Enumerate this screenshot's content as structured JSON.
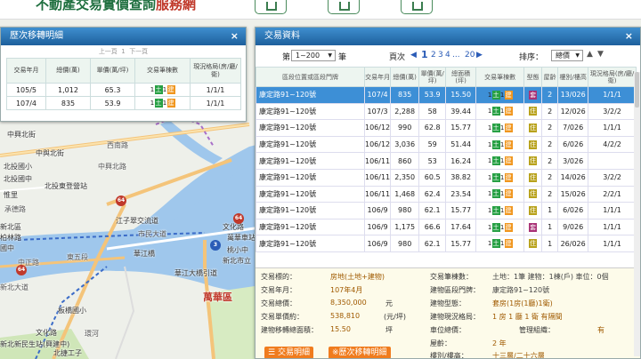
{
  "site": {
    "title_main": "不動產交易實價查詢",
    "title_accent": "服務網"
  },
  "map": {
    "labels": [
      "中興北街",
      "中與北街",
      "西南路",
      "中興北路",
      "北投國小",
      "北投國中",
      "承德路",
      "北投東登營站",
      "江子翠交流道",
      "華江橋",
      "萬華區",
      "華江大橋引道",
      "中正路",
      "文化路",
      "板橋國小",
      "市民大道",
      "東五段",
      "新北大道",
      "文化路",
      "萬華車站",
      "桃小中",
      "新北市立",
      "新北區",
      "柏林路",
      "國中",
      "惟里",
      "新北新民生站(興建中)",
      "北捷工子",
      "環河"
    ],
    "shields": [
      "64",
      "64",
      "3",
      "64"
    ]
  },
  "history": {
    "title": "歷次移轉明細",
    "close": "×",
    "pager": {
      "first": "上一頁",
      "page": "1",
      "next": "下一頁"
    },
    "headers": [
      "交易年月",
      "總價(萬)",
      "單價(萬/坪)",
      "交易筆棟數",
      "現況格局(房/廳/衛)"
    ],
    "rows": [
      {
        "date": "105/5",
        "total": "1,012",
        "unit": "65.3",
        "pattern": "1/1/1"
      },
      {
        "date": "107/4",
        "total": "835",
        "unit": "53.9",
        "pattern": "1/1/1"
      }
    ],
    "tag_land": "土",
    "tag_build": "建",
    "tag_one": "1"
  },
  "tx": {
    "title": "交易資料",
    "close": "×",
    "range_label": "第",
    "range_value": "1~200",
    "range_suffix": "筆",
    "page_label": "頁次",
    "pages": [
      "1",
      "2",
      "3",
      "4",
      "...",
      "20"
    ],
    "sort_label": "排序：",
    "sort_value": "總價",
    "headers": [
      "區段位置或區段門牌",
      "交易年月",
      "總價(萬)",
      "單價(萬/坪)",
      "總面積(坪)",
      "交易筆棟數",
      "型態",
      "屋齡",
      "樓別/樓高",
      "現況格局(房/廳/衛)"
    ],
    "rows": [
      {
        "addr": "康定路91~120號",
        "date": "107/4",
        "total": "835",
        "unit": "53.9",
        "area": "15.50",
        "type": "套",
        "age": "2",
        "floor": "13/026",
        "pattern": "1/1/1",
        "selected": true
      },
      {
        "addr": "康定路91~120號",
        "date": "107/3",
        "total": "2,288",
        "unit": "58",
        "area": "39.44",
        "type": "住",
        "age": "2",
        "floor": "12/026",
        "pattern": "3/2/2"
      },
      {
        "addr": "康定路91~120號",
        "date": "106/12",
        "total": "990",
        "unit": "62.8",
        "area": "15.77",
        "type": "住",
        "age": "2",
        "floor": "7/026",
        "pattern": "1/1/1"
      },
      {
        "addr": "康定路91~120號",
        "date": "106/12",
        "total": "3,036",
        "unit": "59",
        "area": "51.44",
        "type": "住",
        "age": "2",
        "floor": "6/026",
        "pattern": "4/2/2"
      },
      {
        "addr": "康定路91~120號",
        "date": "106/11",
        "total": "860",
        "unit": "53",
        "area": "16.24",
        "type": "住",
        "age": "2",
        "floor": "3/026",
        "pattern": ""
      },
      {
        "addr": "康定路91~120號",
        "date": "106/11",
        "total": "2,350",
        "unit": "60.5",
        "area": "38.82",
        "type": "住",
        "age": "2",
        "floor": "14/026",
        "pattern": "3/2/2"
      },
      {
        "addr": "康定路91~120號",
        "date": "106/11",
        "total": "1,468",
        "unit": "62.4",
        "area": "23.54",
        "type": "住",
        "age": "2",
        "floor": "15/026",
        "pattern": "2/2/1"
      },
      {
        "addr": "康定路91~120號",
        "date": "106/9",
        "total": "980",
        "unit": "62.1",
        "area": "15.77",
        "type": "住",
        "age": "1",
        "floor": "6/026",
        "pattern": "1/1/1"
      },
      {
        "addr": "康定路91~120號",
        "date": "106/9",
        "total": "1,175",
        "unit": "66.6",
        "area": "17.64",
        "type": "套",
        "age": "1",
        "floor": "9/026",
        "pattern": "1/1/1"
      },
      {
        "addr": "康定路91~120號",
        "date": "106/9",
        "total": "980",
        "unit": "62.1",
        "area": "15.77",
        "type": "住",
        "age": "1",
        "floor": "26/026",
        "pattern": "1/1/1"
      }
    ],
    "detail": {
      "object_label": "交易標的：",
      "object_value": "房地(土地+建物)",
      "date_label": "交易年月：",
      "date_value": "107年4月",
      "total_label": "交易總價：",
      "total_value": "8,350,000",
      "total_unit": "元",
      "unit_label": "交易單價約：",
      "unit_value": "538,810",
      "unit_unit": "(元/坪)",
      "area_label": "建物移轉總面積：",
      "area_value": "15.50",
      "area_unit": "坪",
      "count_label": "交易筆棟數：",
      "count_value": "土地：1筆 建物：1棟(戶) 車位：0個",
      "addr_label": "建物區段門牌：",
      "addr_value": "康定路91~120號",
      "type_label": "建物型態：",
      "type_value": "套房(1房(1廳)1衛)",
      "layout_label": "建物現況格局：",
      "layout_value": "1 房 1 廳 1 衛 有隔間",
      "parking_label": "車位總價：",
      "mgmt_label": "管理組織：",
      "mgmt_value": "有",
      "age_label": "屋齡：",
      "age_value": "2 年",
      "floor_label": "樓別/樓高：",
      "floor_value": "十三層/二十六層",
      "btn_tx": "交易明細",
      "btn_history": "※歷次移轉明細"
    }
  }
}
